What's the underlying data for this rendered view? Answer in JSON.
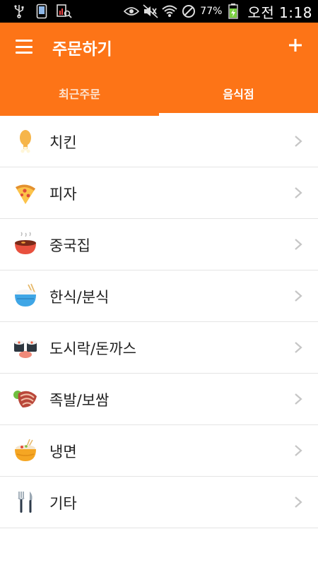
{
  "status_bar": {
    "battery_percent": "77%",
    "time": "오전 1:18",
    "icons": [
      "usb-icon",
      "phone-icon",
      "screenshot-icon",
      "eye-icon",
      "mute-icon",
      "wifi-icon",
      "block-icon",
      "battery-charging-icon"
    ]
  },
  "app_bar": {
    "title": "주문하기",
    "menu_icon": "hamburger-menu-icon",
    "add_icon": "plus-icon",
    "color": "#fd7417"
  },
  "tabs": [
    {
      "label": "최근주문",
      "active": false
    },
    {
      "label": "음식점",
      "active": true
    }
  ],
  "categories": [
    {
      "label": "치킨",
      "icon": "chicken-drumstick-icon"
    },
    {
      "label": "피자",
      "icon": "pizza-slice-icon"
    },
    {
      "label": "중국집",
      "icon": "chinese-bowl-icon"
    },
    {
      "label": "한식/분식",
      "icon": "rice-bowl-icon"
    },
    {
      "label": "도시락/돈까스",
      "icon": "sushi-lunchbox-icon"
    },
    {
      "label": "족발/보쌈",
      "icon": "pork-meat-icon"
    },
    {
      "label": "냉면",
      "icon": "cold-noodle-bowl-icon"
    },
    {
      "label": "기타",
      "icon": "fork-knife-icon"
    }
  ]
}
